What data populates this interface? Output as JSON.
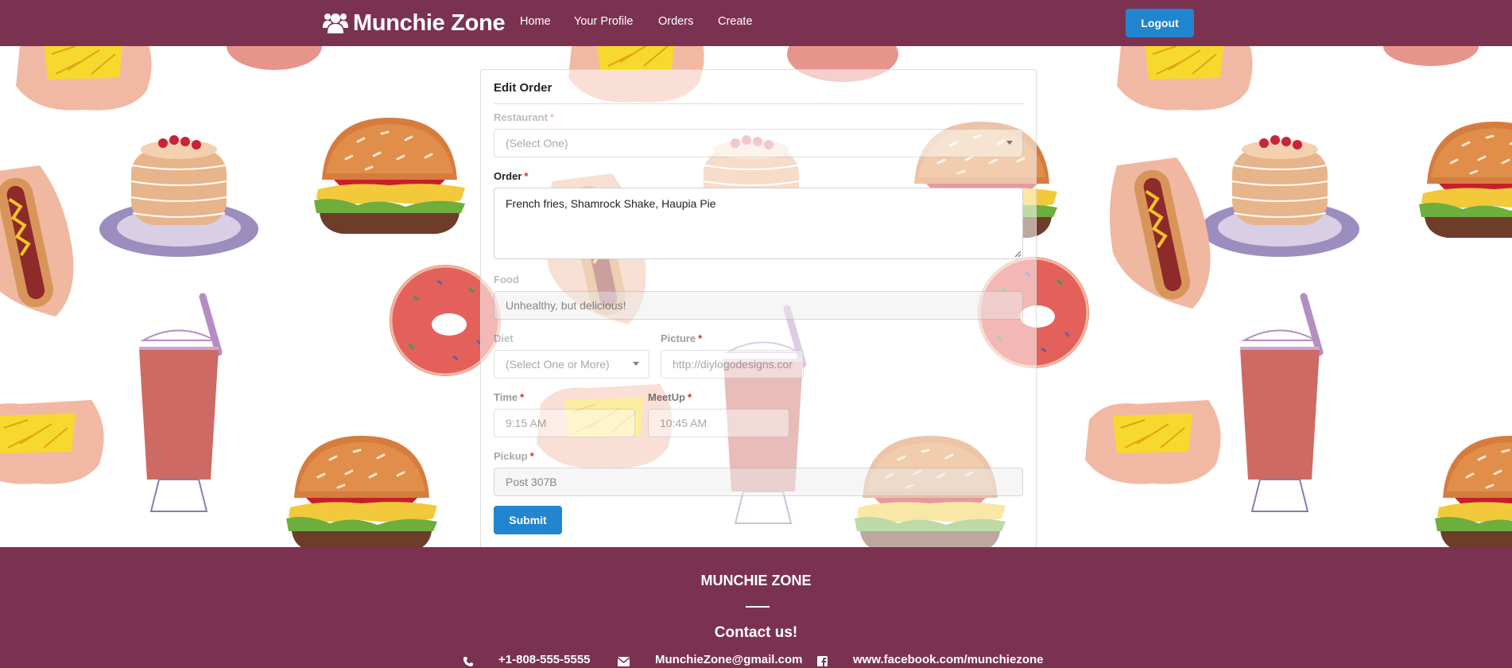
{
  "navbar": {
    "brand": "Munchie Zone",
    "links": [
      "Home",
      "Your Profile",
      "Orders",
      "Create"
    ],
    "logout_label": "Logout"
  },
  "form": {
    "title": "Edit Order",
    "restaurant": {
      "label": "Restaurant",
      "placeholder": "(Select One)"
    },
    "order": {
      "label": "Order",
      "value": "French fries,  Shamrock Shake, Haupia Pie"
    },
    "food": {
      "label": "Food",
      "value": "Unhealthy, but delicious!"
    },
    "diet": {
      "label": "Diet",
      "placeholder": "(Select One or More)"
    },
    "picture": {
      "label": "Picture",
      "value": "http://diylogodesigns.cor"
    },
    "time": {
      "label": "Time",
      "value": "9:15 AM"
    },
    "meetup": {
      "label": "MeetUp",
      "value": "10:45 AM"
    },
    "pickup": {
      "label": "Pickup",
      "value": "Post 307B"
    },
    "submit_label": "Submit",
    "required_mark": "*"
  },
  "footer": {
    "title": "MUNCHIE ZONE",
    "contact_heading": "Contact us!",
    "phone": "+1-808-555-5555",
    "email": "MunchieZone@gmail.com",
    "facebook": "www.facebook.com/munchiezone"
  },
  "colors": {
    "brand": "#7b3251",
    "primary_button": "#2185d0",
    "required": "#db2828"
  },
  "icons": [
    "users-icon",
    "phone-icon",
    "envelope-icon",
    "facebook-icon",
    "caret-down-icon"
  ]
}
